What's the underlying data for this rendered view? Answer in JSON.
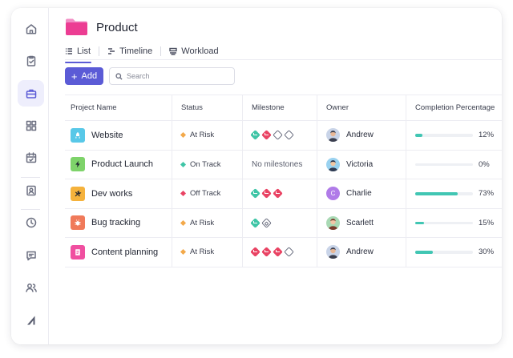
{
  "title": "Product",
  "tabs": [
    {
      "label": "List",
      "icon": "list-icon",
      "active": true
    },
    {
      "label": "Timeline",
      "icon": "timeline-icon",
      "active": false
    },
    {
      "label": "Workload",
      "icon": "workload-icon",
      "active": false
    }
  ],
  "toolbar": {
    "add_label": "Add",
    "search_placeholder": "Search"
  },
  "sidebar": {
    "items": [
      {
        "icon": "home-icon"
      },
      {
        "icon": "clipboard-icon"
      },
      {
        "icon": "briefcase-icon",
        "active": true
      },
      {
        "icon": "dashboard-icon"
      },
      {
        "icon": "calendar-icon"
      },
      {
        "icon": "contact-icon"
      },
      {
        "icon": "clock-icon"
      },
      {
        "icon": "chat-icon"
      },
      {
        "icon": "people-icon"
      },
      {
        "icon": "logo-icon"
      }
    ]
  },
  "table": {
    "headers": [
      "Project Name",
      "Status",
      "Milestone",
      "Owner",
      "Completion Percentage"
    ],
    "rows": [
      {
        "name": "Website",
        "icon": "rocket-icon",
        "icon_color": "#58c8e8",
        "status": "At Risk",
        "status_color": "#f3a94a",
        "milestones": [
          "done-teal",
          "done-red",
          "open",
          "open"
        ],
        "milestone_text": "",
        "owner": "Andrew",
        "avatar": "photo",
        "progress": 12,
        "progress_label": "12%"
      },
      {
        "name": "Product Launch",
        "icon": "bolt-icon",
        "icon_color": "#7ed36a",
        "status": "On Track",
        "status_color": "#3fc5a6",
        "milestones": [],
        "milestone_text": "No milestones",
        "owner": "Victoria",
        "avatar": "photo",
        "progress": 0,
        "progress_label": "0%"
      },
      {
        "name": "Dev works",
        "icon": "tools-icon",
        "icon_color": "#f5b23c",
        "status": "Off Track",
        "status_color": "#e94363",
        "milestones": [
          "done-teal",
          "done-red",
          "done-red"
        ],
        "milestone_text": "",
        "owner": "Charlie",
        "avatar": "C",
        "avatar_color": "#b07be8",
        "progress": 73,
        "progress_label": "73%"
      },
      {
        "name": "Bug tracking",
        "icon": "bug-icon",
        "icon_color": "#f07a5a",
        "status": "At Risk",
        "status_color": "#f3a94a",
        "milestones": [
          "done-teal",
          "half"
        ],
        "milestone_text": "",
        "owner": "Scarlett",
        "avatar": "photo",
        "progress": 15,
        "progress_label": "15%"
      },
      {
        "name": "Content planning",
        "icon": "document-icon",
        "icon_color": "#f04fa0",
        "status": "At Risk",
        "status_color": "#f3a94a",
        "milestones": [
          "done-red",
          "done-red",
          "done-red",
          "open"
        ],
        "milestone_text": "",
        "owner": "Andrew",
        "avatar": "photo",
        "progress": 30,
        "progress_label": "30%"
      }
    ]
  },
  "colors": {
    "accent": "#5b5bd6",
    "progress": "#41c6b3",
    "milestone_teal": "#3fc5a6",
    "milestone_red": "#e94363"
  }
}
